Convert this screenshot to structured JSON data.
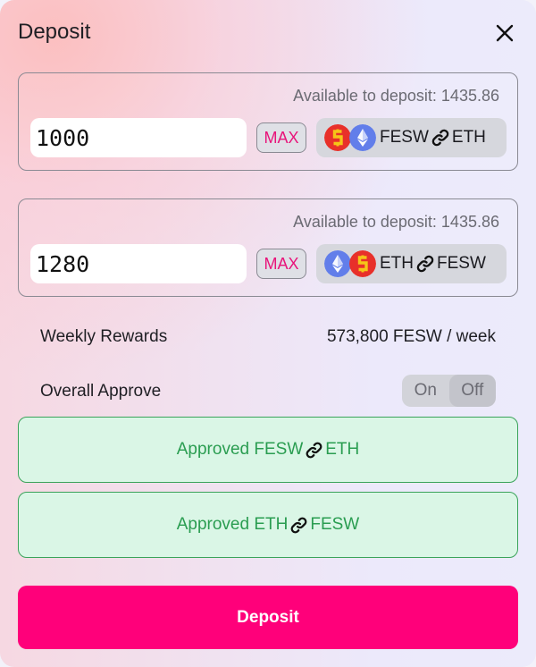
{
  "modal": {
    "title": "Deposit"
  },
  "token_a": {
    "available_text": "Available to deposit: 1435.86",
    "amount": "1000",
    "max_label": "MAX",
    "pair": {
      "first": "FESW",
      "second": "ETH",
      "first_icon": "fesw-coin-icon",
      "second_icon": "eth-coin-icon"
    }
  },
  "token_b": {
    "available_text": "Available to deposit: 1435.86",
    "amount": "1280",
    "max_label": "MAX",
    "pair": {
      "first": "ETH",
      "second": "FESW",
      "first_icon": "eth-coin-icon",
      "second_icon": "fesw-coin-icon"
    }
  },
  "rewards": {
    "label": "Weekly Rewards",
    "value": "573,800 FESW / week"
  },
  "approve": {
    "label": "Overall Approve",
    "on_label": "On",
    "off_label": "Off",
    "selected": "Off"
  },
  "approved_buttons": [
    {
      "prefix": "Approved FESW",
      "suffix": "ETH"
    },
    {
      "prefix": "Approved ETH",
      "suffix": "FESW"
    }
  ],
  "deposit_button": {
    "label": "Deposit"
  },
  "colors": {
    "accent": "#ff007a",
    "max_text": "#e8147a",
    "approved_text": "#2a9d51",
    "approved_bg": "#daf6e6",
    "fesw_coin": "#e8302a",
    "fesw_symbol": "#f5c518",
    "eth_coin": "#627eea"
  }
}
